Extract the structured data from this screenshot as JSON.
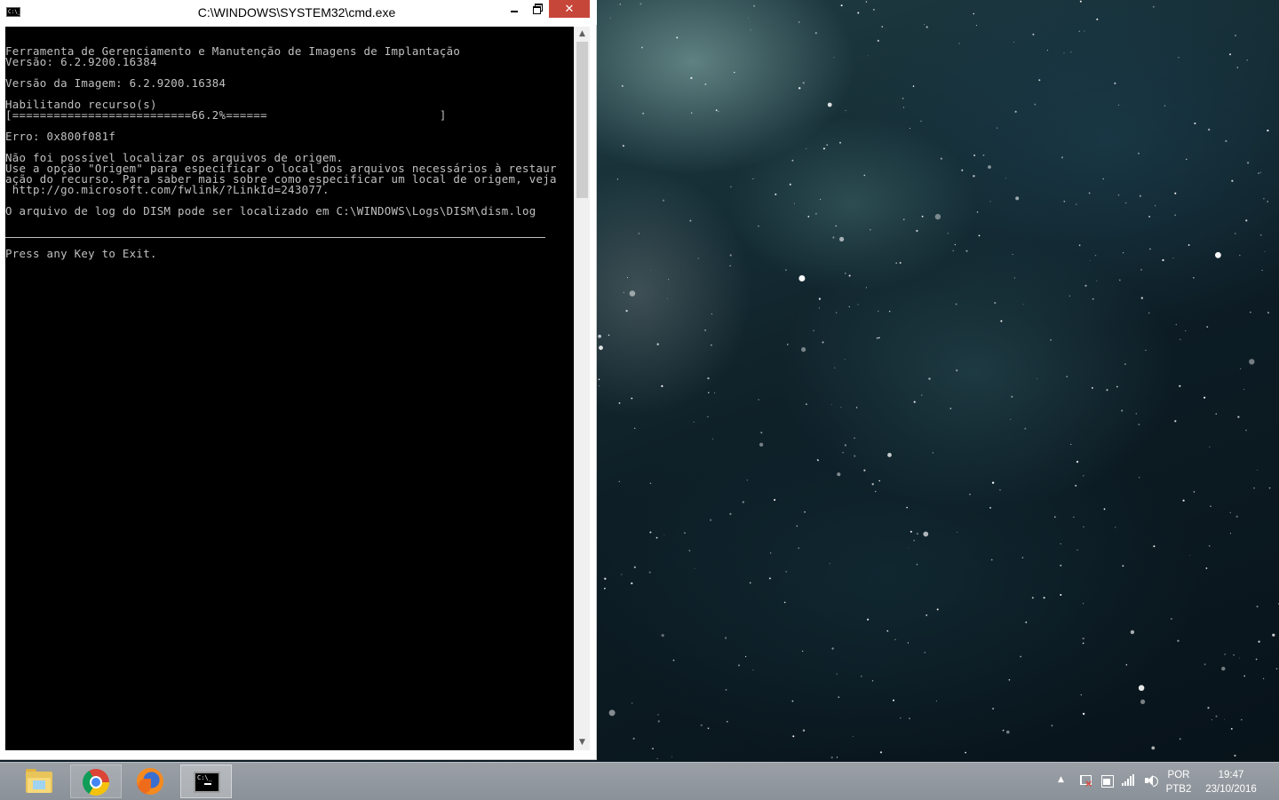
{
  "window": {
    "title": "C:\\WINDOWS\\SYSTEM32\\cmd.exe",
    "icon_text": "C:\\_",
    "minimize_icon": "minimize-icon",
    "restore_icon": "restore-icon",
    "close_glyph": "✕"
  },
  "console": {
    "lines": [
      "Ferramenta de Gerenciamento e Manutenção de Imagens de Implantação",
      "Versão: 6.2.9200.16384",
      "",
      "Versão da Imagem: 6.2.9200.16384",
      "",
      "Habilitando recurso(s)",
      "[==========================66.2%======                         ]",
      "",
      "Erro: 0x800f081f",
      "",
      "Não foi possível localizar os arquivos de origem.",
      "Use a opção \"Origem\" para especificar o local dos arquivos necessários à restaur",
      "ação do recurso. Para saber mais sobre como especificar um local de origem, veja",
      " http://go.microsoft.com/fwlink/?LinkId=243077.",
      "",
      "O arquivo de log do DISM pode ser localizado em C:\\WINDOWS\\Logs\\DISM\\dism.log",
      "",
      "",
      "",
      "Press any Key to Exit."
    ],
    "progress_percent": 66.2
  },
  "scrollbar": {
    "up_glyph": "▲",
    "down_glyph": "▼"
  },
  "taskbar": {
    "apps": [
      {
        "name": "file-explorer",
        "icon": "folder-icon"
      },
      {
        "name": "google-chrome",
        "icon": "chrome-icon"
      },
      {
        "name": "firefox",
        "icon": "firefox-icon"
      },
      {
        "name": "command-prompt",
        "icon": "cmd-icon",
        "active": true
      }
    ],
    "tray": {
      "arrow_glyph": "▲",
      "icons": [
        "action-center-flag-icon",
        "battery-icon",
        "network-signal-icon",
        "volume-icon"
      ],
      "language": "POR",
      "keyboard": "PTB2",
      "time": "19:47",
      "date": "23/10/2016"
    }
  },
  "colors": {
    "console_bg": "#000000",
    "console_text": "#c0c0c0",
    "close_button": "#c7463a",
    "taskbar": "#949aa0"
  }
}
